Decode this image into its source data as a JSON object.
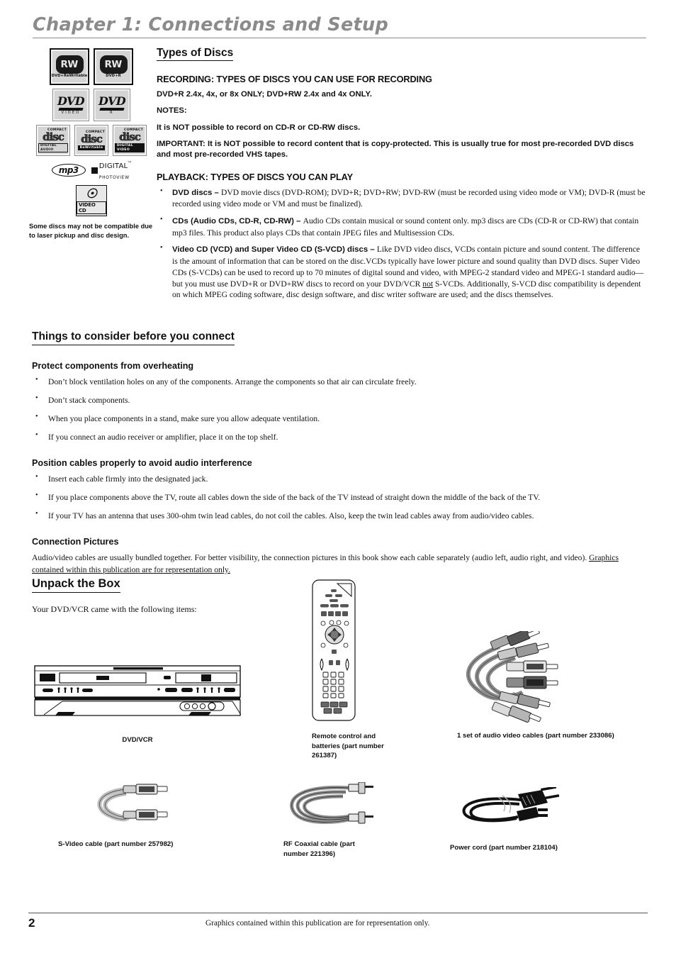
{
  "chapter": {
    "title": "Chapter 1: Connections and Setup"
  },
  "disc_logos": {
    "rw_rewritable": {
      "badge": "RW",
      "caption": "DVD+ReWritable"
    },
    "rw_r": {
      "badge": "RW",
      "caption": "DVD+R"
    },
    "dvd_video": {
      "word": "DVD",
      "sub": "VIDEO"
    },
    "dvd_r": {
      "word": "DVD",
      "sub": "R"
    },
    "cd_digital_audio": {
      "top": "COMPACT",
      "mid": "disc",
      "bottom": "DIGITAL AUDIO"
    },
    "cd_recordable": {
      "top": "COMPACT",
      "mid": "disc",
      "bottom": "ReWritable"
    },
    "cd_digital_video": {
      "top": "COMPACT",
      "mid": "disc",
      "bottom": "DIGITAL VIDEO"
    },
    "mp3": "mp3",
    "digital_photoview": {
      "line1": "DIGITAL",
      "line2": "PHOTOVIEW",
      "tm": "™"
    },
    "video_cd": {
      "label": "VIDEO CD"
    },
    "compat_note": "Some discs may not be compatible due to laser pickup and disc design."
  },
  "types_of_discs": {
    "heading": "Types of Discs",
    "recording_heading": "RECORDING: TYPES OF DISCS YOU CAN USE FOR RECORDING",
    "recording_line": "DVD+R 2.4x, 4x, or 8x ONLY; DVD+RW 2.4x and 4x ONLY.",
    "notes_label": "NOTES:",
    "note_1": "It is NOT possible to record on CD-R or CD-RW discs.",
    "note_2": "IMPORTANT: It is NOT possible to record content that is copy-protected. This is usually true for most pre-recorded DVD discs and most pre-recorded VHS tapes.",
    "playback_heading": "PLAYBACK: TYPES OF DISCS YOU CAN PLAY",
    "playback_items": [
      {
        "term": "DVD discs – ",
        "text": "DVD movie discs (DVD-ROM); DVD+R; DVD+RW; DVD-RW (must be recorded using video mode or VM); DVD-R (must be recorded using video mode or VM and must be finalized)."
      },
      {
        "term": "CDs (Audio CDs, CD-R, CD-RW) – ",
        "text": "Audio CDs contain musical or sound content only. mp3 discs are CDs (CD-R or CD-RW) that contain mp3 files. This product also plays CDs that contain JPEG files and Multisession CDs."
      },
      {
        "term": "Video CD (VCD) and Super Video CD (S-VCD) discs – ",
        "text_a": "Like DVD video discs, VCDs contain picture and sound content. The difference is the amount of information that can be stored on the disc.VCDs typically have lower picture and sound quality than DVD discs. Super Video CDs (S-VCDs) can be used to record up to 70 minutes of digital sound and video, with MPEG-2 standard video and MPEG-1 standard audio—but you must use DVD+R or DVD+RW discs to record on your DVD/VCR ",
        "underlined": "not",
        "text_b": " S-VCDs. Additionally, S-VCD disc compatibility is dependent on which MPEG coding software, disc design software, and disc writer software are used; and the discs themselves."
      }
    ]
  },
  "things_to_consider": {
    "heading": "Things to consider before you connect",
    "overheating": {
      "subhead": "Protect components from overheating",
      "items": [
        "Don’t block ventilation holes on any of the components. Arrange the components so that air can circulate freely.",
        "Don’t stack components.",
        "When you place components in a stand, make sure you allow adequate ventilation.",
        "If you connect an audio receiver or amplifier, place it on the top shelf."
      ]
    },
    "position_cables": {
      "subhead": "Position cables properly to avoid audio interference",
      "items": [
        "Insert each cable firmly into the designated jack.",
        "If you place components above the TV, route all cables down the side of the back of the TV instead of straight down the middle of the back of the TV.",
        "If your TV has an antenna that uses 300-ohm twin lead cables, do not coil the cables. Also, keep the twin lead cables away from audio/video cables."
      ]
    },
    "connection_pictures": {
      "subhead": "Connection Pictures",
      "para": "Audio/video cables are usually bundled together. For better visibility, the connection pictures in this book show each cable separately (audio left, audio right, and video).",
      "underlined": "Graphics contained within this publication are for representation only."
    }
  },
  "unpack": {
    "heading": "Unpack the Box",
    "intro": "Your DVD/VCR came with the following items:",
    "items": [
      {
        "caption": "DVD/VCR"
      },
      {
        "caption": "Remote control and batteries (part number 261387)"
      },
      {
        "caption": "1 set of audio video cables (part number 233086)"
      },
      {
        "caption": "S-Video cable (part number 257982)"
      },
      {
        "caption": "RF Coaxial cable (part number 221396)"
      },
      {
        "caption": "Power cord (part number 218104)"
      }
    ]
  },
  "footer": {
    "page_number": "2",
    "note": "Graphics contained within this publication are for representation only."
  },
  "colors": {
    "chapter_gray": "#8b8b8b",
    "text": "#111111",
    "logo_fill": "#d4d4d4"
  }
}
